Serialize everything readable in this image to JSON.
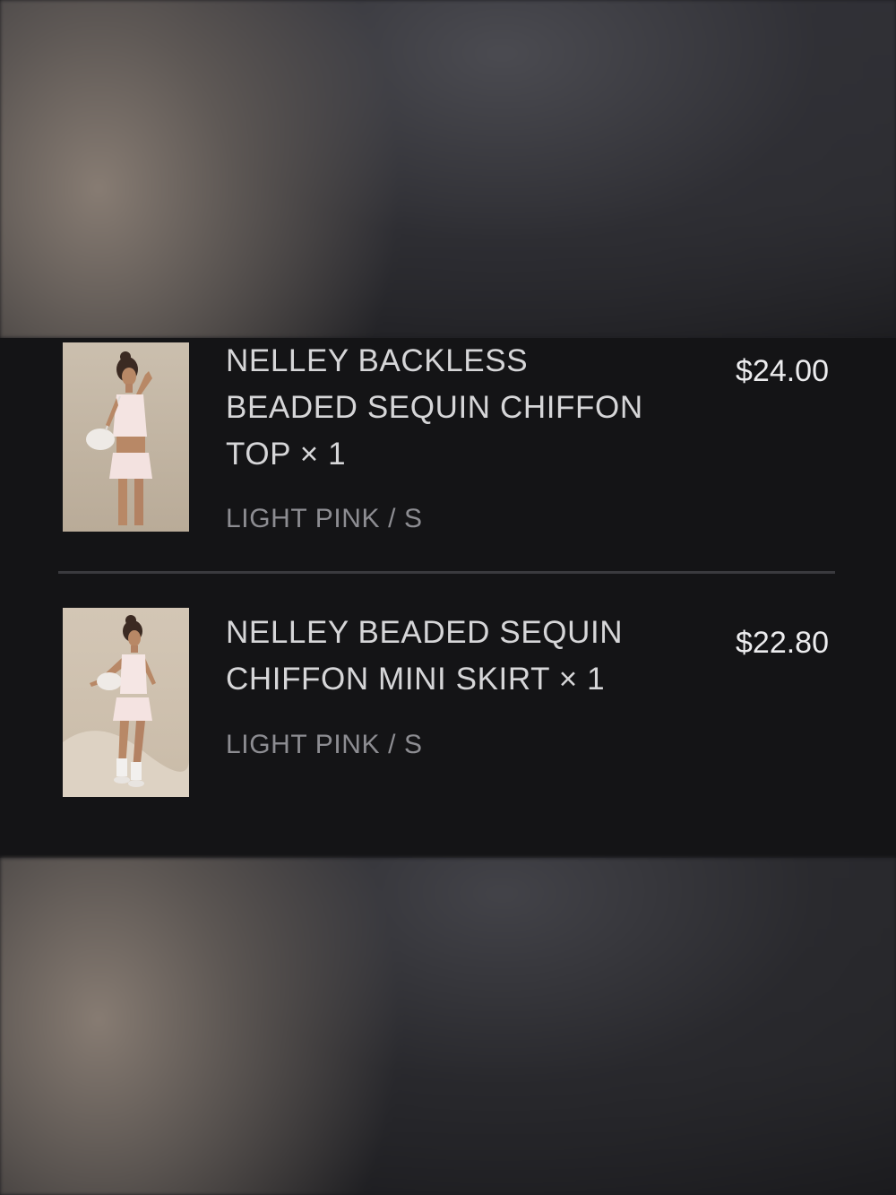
{
  "cart": {
    "items": [
      {
        "title_line1": "NELLEY BACKLESS",
        "title_line2": "BEADED SEQUIN CHIFFON",
        "title_line3": "TOP × 1",
        "variant": "LIGHT PINK / S",
        "price": "$24.00",
        "image_icon": "product-photo-top"
      },
      {
        "title_line1": "NELLEY BEADED SEQUIN",
        "title_line2": "CHIFFON MINI SKIRT × 1",
        "variant": "LIGHT PINK / S",
        "price": "$22.80",
        "image_icon": "product-photo-skirt"
      }
    ]
  },
  "colors": {
    "panel_bg": "#141416",
    "title_text": "#d6d6d8",
    "variant_text": "#8d8d92",
    "price_text": "#ececee",
    "divider": "#3a3a3e"
  }
}
